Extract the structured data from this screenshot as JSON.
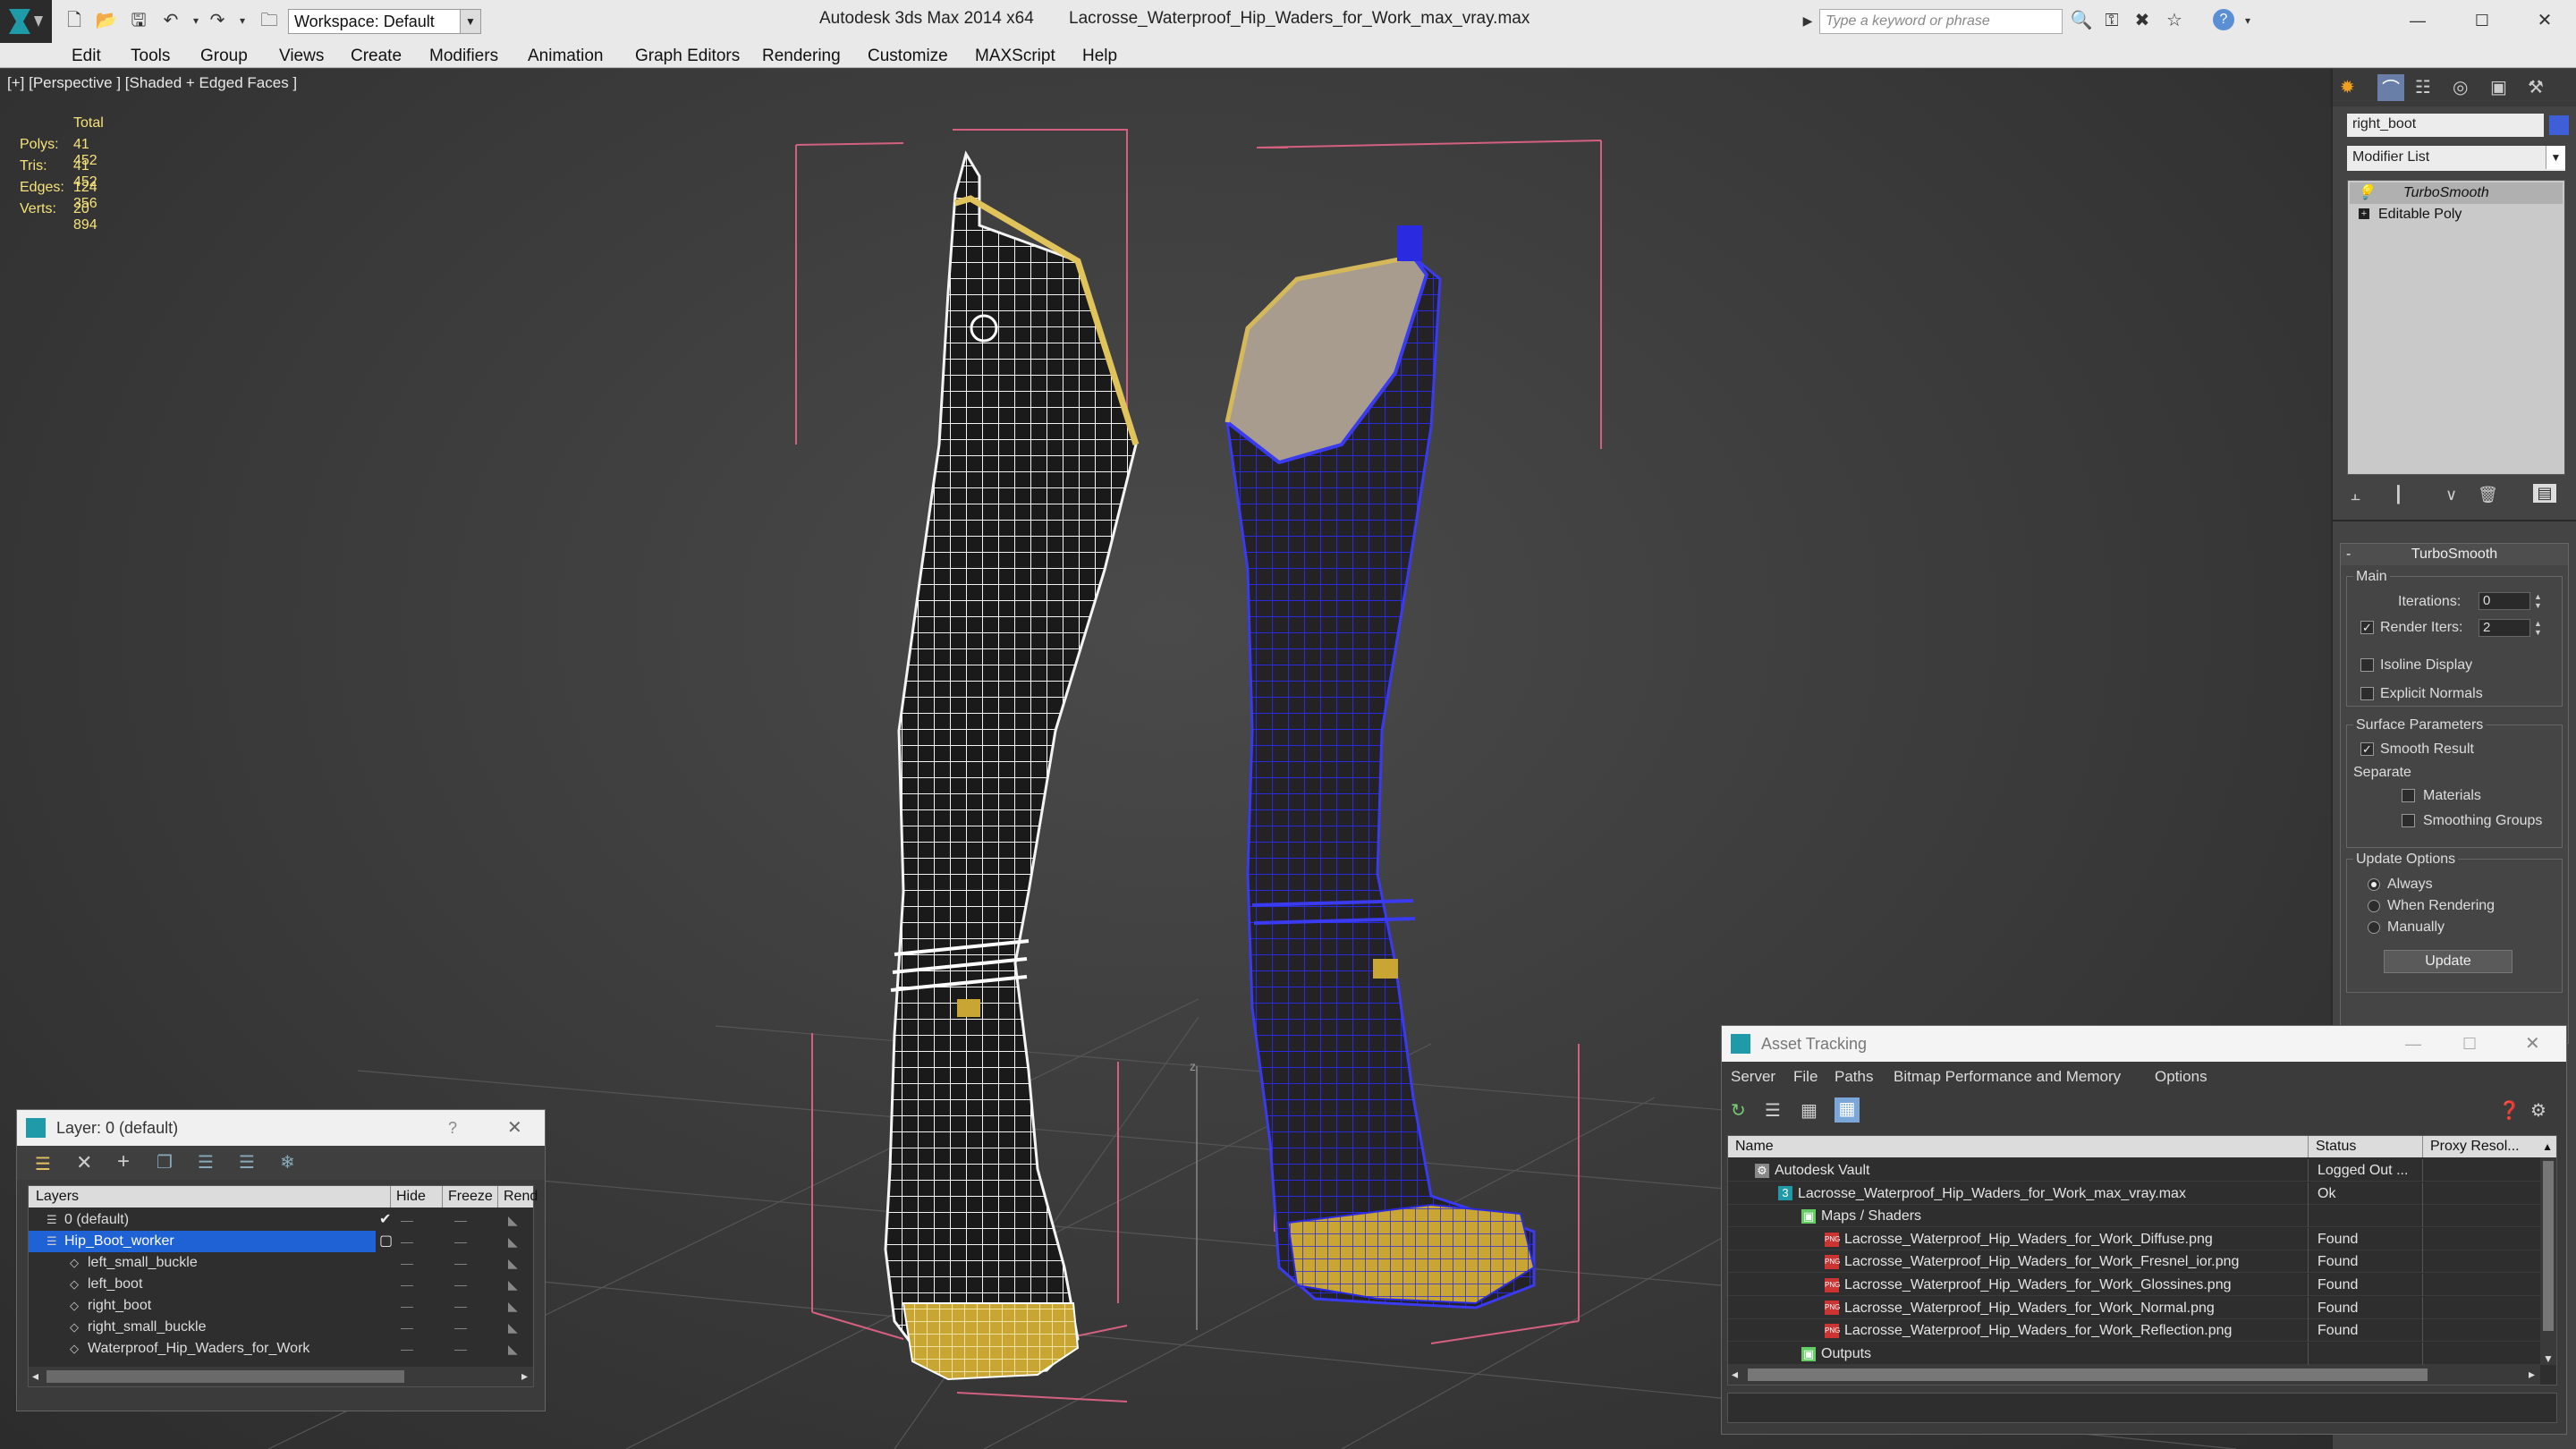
{
  "titlebar": {
    "app_title": "Autodesk 3ds Max  2014 x64",
    "file_name": "Lacrosse_Waterproof_Hip_Waders_for_Work_max_vray.max",
    "workspace": "Workspace: Default",
    "search_placeholder": "Type a keyword or phrase"
  },
  "menu": [
    "Edit",
    "Tools",
    "Group",
    "Views",
    "Create",
    "Modifiers",
    "Animation",
    "Graph Editors",
    "Rendering",
    "Customize",
    "MAXScript",
    "Help"
  ],
  "viewport": {
    "label": "[+] [Perspective ] [Shaded + Edged Faces ]",
    "stats": {
      "header": "Total",
      "polys_label": "Polys:",
      "polys": "41 452",
      "tris_label": "Tris:",
      "tris": "41 452",
      "edges_label": "Edges:",
      "edges": "124 356",
      "verts_label": "Verts:",
      "verts": "20 894"
    }
  },
  "command_panel": {
    "object_name": "right_boot",
    "object_color": "#3f5fd8",
    "modifier_list": "Modifier List",
    "stack": [
      "TurboSmooth",
      "Editable Poly"
    ],
    "rollout_title": "TurboSmooth",
    "main_label": "Main",
    "iterations_label": "Iterations:",
    "iterations": "0",
    "render_iters_label": "Render Iters:",
    "render_iters": "2",
    "isoline_label": "Isoline Display",
    "explicit_label": "Explicit Normals",
    "surface_label": "Surface Parameters",
    "smooth_label": "Smooth Result",
    "separate_label": "Separate",
    "materials_label": "Materials",
    "smoothing_label": "Smoothing Groups",
    "update_options_label": "Update Options",
    "always_label": "Always",
    "when_rendering_label": "When Rendering",
    "manually_label": "Manually",
    "update_button": "Update"
  },
  "layer_window": {
    "title": "Layer: 0 (default)",
    "help": "?",
    "columns": [
      "Layers",
      "Hide",
      "Freeze",
      "Rend"
    ],
    "rows": [
      {
        "name": "0 (default)",
        "indent": 0,
        "selected": false
      },
      {
        "name": "Hip_Boot_worker",
        "indent": 0,
        "selected": true
      },
      {
        "name": "left_small_buckle",
        "indent": 1,
        "selected": false
      },
      {
        "name": "left_boot",
        "indent": 1,
        "selected": false
      },
      {
        "name": "right_boot",
        "indent": 1,
        "selected": false
      },
      {
        "name": "right_small_buckle",
        "indent": 1,
        "selected": false
      },
      {
        "name": "Waterproof_Hip_Waders_for_Work",
        "indent": 1,
        "selected": false
      }
    ]
  },
  "asset_window": {
    "title": "Asset Tracking",
    "menu": [
      "Server",
      "File",
      "Paths",
      "Bitmap Performance and Memory",
      "Options"
    ],
    "columns": [
      "Name",
      "Status",
      "Proxy Resol..."
    ],
    "rows": [
      {
        "name": "Autodesk Vault",
        "status": "Logged Out ...",
        "level": 0,
        "icon": "vault"
      },
      {
        "name": "Lacrosse_Waterproof_Hip_Waders_for_Work_max_vray.max",
        "status": "Ok",
        "level": 1,
        "icon": "max"
      },
      {
        "name": "Maps / Shaders",
        "status": "",
        "level": 2,
        "icon": "folder"
      },
      {
        "name": "Lacrosse_Waterproof_Hip_Waders_for_Work_Diffuse.png",
        "status": "Found",
        "level": 3,
        "icon": "png"
      },
      {
        "name": "Lacrosse_Waterproof_Hip_Waders_for_Work_Fresnel_ior.png",
        "status": "Found",
        "level": 3,
        "icon": "png"
      },
      {
        "name": "Lacrosse_Waterproof_Hip_Waders_for_Work_Glossines.png",
        "status": "Found",
        "level": 3,
        "icon": "png"
      },
      {
        "name": "Lacrosse_Waterproof_Hip_Waders_for_Work_Normal.png",
        "status": "Found",
        "level": 3,
        "icon": "png"
      },
      {
        "name": "Lacrosse_Waterproof_Hip_Waders_for_Work_Reflection.png",
        "status": "Found",
        "level": 3,
        "icon": "png"
      },
      {
        "name": "Outputs",
        "status": "",
        "level": 2,
        "icon": "folder"
      }
    ]
  }
}
